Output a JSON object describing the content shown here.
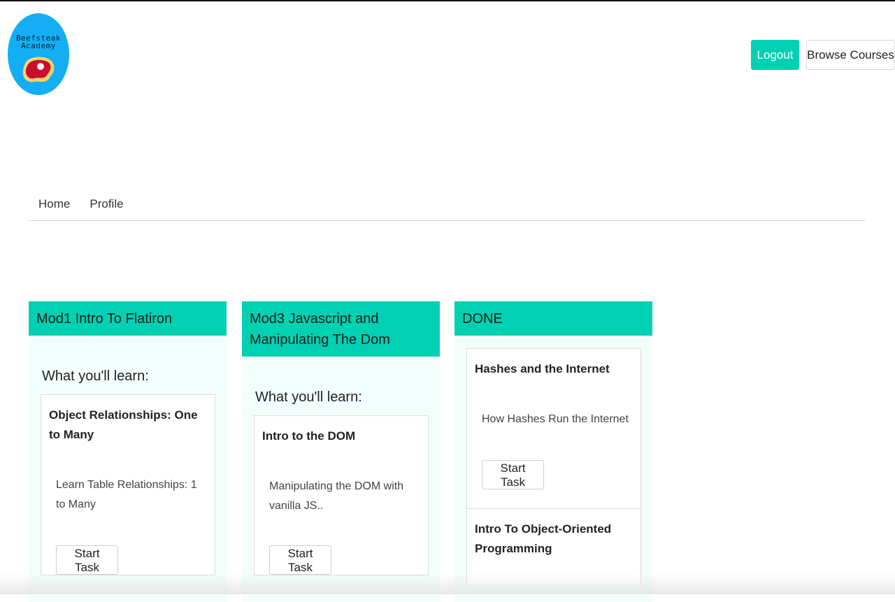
{
  "logo": {
    "line1": "Beefsteak",
    "line2": "Academy",
    "icon": "steak-icon"
  },
  "header": {
    "logout_label": "Logout",
    "browse_label": "Browse Courses"
  },
  "nav": {
    "tabs": [
      "Home",
      "Profile"
    ]
  },
  "columns": [
    {
      "title": "Mod1 Intro To Flatiron",
      "learn_label": "What you'll learn:",
      "cards": [
        {
          "title": "Object Relationships: One to Many",
          "description": "Learn Table Relationships: 1 to Many",
          "button": "Start Task"
        }
      ]
    },
    {
      "title": "Mod3 Javascript and Manipulating The Dom",
      "learn_label": "What you'll learn:",
      "cards": [
        {
          "title": "Intro to the DOM",
          "description": "Manipulating the DOM with vanilla JS..",
          "button": "Start Task"
        }
      ]
    },
    {
      "title": "DONE",
      "cards": [
        {
          "title": "Hashes and the Internet",
          "description": "How Hashes Run the Internet",
          "button": "Start Task"
        },
        {
          "title": "Intro To Object-Oriented Programming"
        }
      ]
    }
  ],
  "colors": {
    "accent": "#00d1b2",
    "logo_bg": "#14aef5",
    "column_bg": "#f2fefc"
  }
}
